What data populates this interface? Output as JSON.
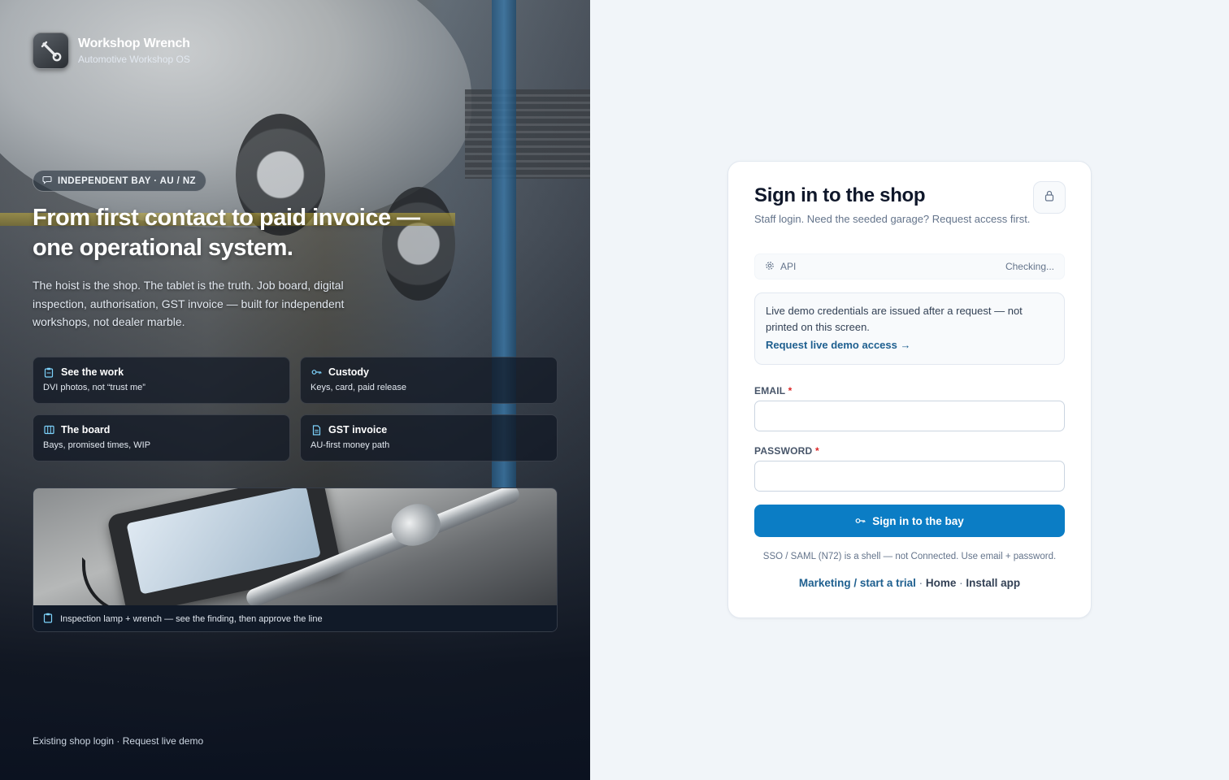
{
  "brand": {
    "name": "Workshop Wrench",
    "subtitle": "Automotive Workshop OS",
    "logo_icon": "wrench-icon"
  },
  "hero": {
    "pill_label": "INDEPENDENT BAY · AU / NZ",
    "headline": "From first contact to paid invoice — one operational system.",
    "lede": "The hoist is the shop. The tablet is the truth. Job board, digital inspection, authorisation, GST invoice — built for independent workshops, not dealer marble.",
    "features": [
      {
        "title": "See the work",
        "desc": "DVI photos, not “trust me”",
        "icon": "clipboard-icon"
      },
      {
        "title": "Custody",
        "desc": "Keys, card, paid release",
        "icon": "key-icon"
      },
      {
        "title": "The board",
        "desc": "Bays, promised times, WIP",
        "icon": "board-icon"
      },
      {
        "title": "GST invoice",
        "desc": "AU-first money path",
        "icon": "document-icon"
      }
    ],
    "photo_caption": "Inspection lamp + wrench — see the finding, then approve the line",
    "footer": {
      "login_text": "Existing shop login",
      "separator": " · ",
      "demo_text": "Request live demo"
    }
  },
  "signin": {
    "title": "Sign in to the shop",
    "subtitle": "Staff login. Need the seeded garage? Request access first.",
    "api_label": "API",
    "api_status": "Checking...",
    "notice_text": "Live demo credentials are issued after a request — not printed on this screen.",
    "notice_link": "Request live demo access →",
    "email_label": "EMAIL",
    "email_value": "",
    "password_label": "PASSWORD",
    "password_value": "",
    "required_mark": "*",
    "submit_label": "Sign in to the bay",
    "sso_note": "SSO / SAML (N72) is a shell — not Connected. Use email + password.",
    "links": {
      "marketing": "Marketing / start a trial",
      "home": "Home",
      "install": "Install app",
      "separator": " · "
    }
  },
  "colors": {
    "accent": "#0b7dc5",
    "link": "#1e5f8f",
    "required": "#dc2626",
    "page_bg": "#f1f5f9"
  }
}
